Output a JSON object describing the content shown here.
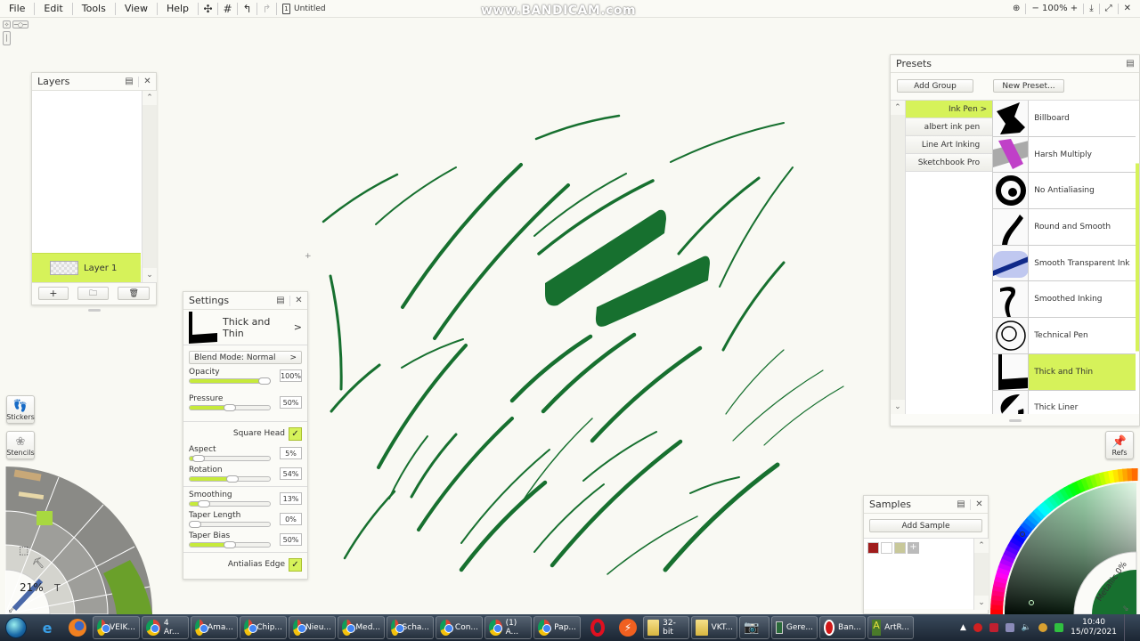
{
  "menubar": {
    "items": [
      "File",
      "Edit",
      "Tools",
      "View",
      "Help"
    ],
    "toolbar_icons": [
      "transform-icon",
      "grid-icon",
      "undo-icon",
      "redo-icon"
    ],
    "document_title": "Untitled",
    "zoom_level": "100%",
    "zoom_minus": "−",
    "zoom_plus": "+",
    "watermark": "www.BANDICAM.com"
  },
  "layers": {
    "title": "Layers",
    "items": [
      {
        "name": "Layer 1",
        "selected": true
      }
    ],
    "add_label": "+",
    "folder_label": "folder",
    "delete_label": "delete"
  },
  "settings": {
    "title": "Settings",
    "preset_name": "Thick and Thin",
    "blend_mode": "Blend Mode: Normal",
    "sliders": [
      {
        "label": "Opacity",
        "value": "100%",
        "fraction": 1.0
      },
      {
        "label": "Pressure",
        "value": "50%",
        "fraction": 0.5
      },
      {
        "label": "Aspect",
        "value": "5%",
        "fraction": 0.05
      },
      {
        "label": "Rotation",
        "value": "54%",
        "fraction": 0.54
      },
      {
        "label": "Smoothing",
        "value": "13%",
        "fraction": 0.13
      },
      {
        "label": "Taper Length",
        "value": "0%",
        "fraction": 0.0
      },
      {
        "label": "Taper Bias",
        "value": "50%",
        "fraction": 0.5
      }
    ],
    "square_head": {
      "label": "Square Head",
      "checked": true
    },
    "antialias_edge": {
      "label": "Antialias Edge",
      "checked": true
    }
  },
  "presets": {
    "title": "Presets",
    "add_group": "Add Group",
    "new_preset": "New Preset...",
    "groups": [
      {
        "label": "Ink Pen >",
        "active": true
      },
      {
        "label": "albert ink pen",
        "active": false
      },
      {
        "label": "Line Art Inking",
        "active": false
      },
      {
        "label": "Sketchbook Pro",
        "active": false
      }
    ],
    "items": [
      {
        "name": "Billboard",
        "active": false
      },
      {
        "name": "Harsh Multiply",
        "active": false
      },
      {
        "name": "No Antialiasing",
        "active": false
      },
      {
        "name": "Round and Smooth",
        "active": false
      },
      {
        "name": "Smooth Transparent Ink",
        "active": false
      },
      {
        "name": "Smoothed Inking",
        "active": false
      },
      {
        "name": "Technical Pen",
        "active": false
      },
      {
        "name": "Thick and Thin",
        "active": true
      },
      {
        "name": "Thick Liner",
        "active": false
      }
    ]
  },
  "samples": {
    "title": "Samples",
    "add_sample": "Add Sample",
    "swatches": [
      "#a01c1c",
      "#ffffff",
      "#c8c89a"
    ],
    "add_swatch": "+"
  },
  "side_buttons": {
    "stickers": "Stickers",
    "stencils": "Stencils",
    "refs": "Refs"
  },
  "tool_wheel": {
    "size_percent": "21%",
    "active_tool": "ink-pen"
  },
  "color_picker": {
    "metallic": "Metallic 0%",
    "current_color": "#17702f"
  },
  "canvas": {
    "stroke_color": "#17702f",
    "background": "#f9f9f3"
  },
  "taskbar": {
    "tasks": [
      {
        "icon": "chrome",
        "label": "VEIK..."
      },
      {
        "icon": "chrome",
        "label": "4 Ar..."
      },
      {
        "icon": "chrome",
        "label": "Ama..."
      },
      {
        "icon": "chrome",
        "label": "Chip..."
      },
      {
        "icon": "chrome",
        "label": "Nieu..."
      },
      {
        "icon": "chrome",
        "label": "Med..."
      },
      {
        "icon": "chrome",
        "label": "Scha..."
      },
      {
        "icon": "chrome",
        "label": "Con..."
      },
      {
        "icon": "chrome",
        "label": "(1) A..."
      },
      {
        "icon": "chrome",
        "label": "Pap..."
      }
    ],
    "pinned": [
      "opera",
      "flash"
    ],
    "tasks2": [
      {
        "icon": "folder",
        "label": "32-bit"
      },
      {
        "icon": "folder",
        "label": "VKT..."
      },
      {
        "icon": "camera",
        "label": ""
      },
      {
        "icon": "monitor",
        "label": "Gere..."
      },
      {
        "icon": "record",
        "label": "Ban..."
      },
      {
        "icon": "artrage",
        "label": "ArtR..."
      }
    ],
    "time": "10:40",
    "date": "15/07/2021"
  }
}
